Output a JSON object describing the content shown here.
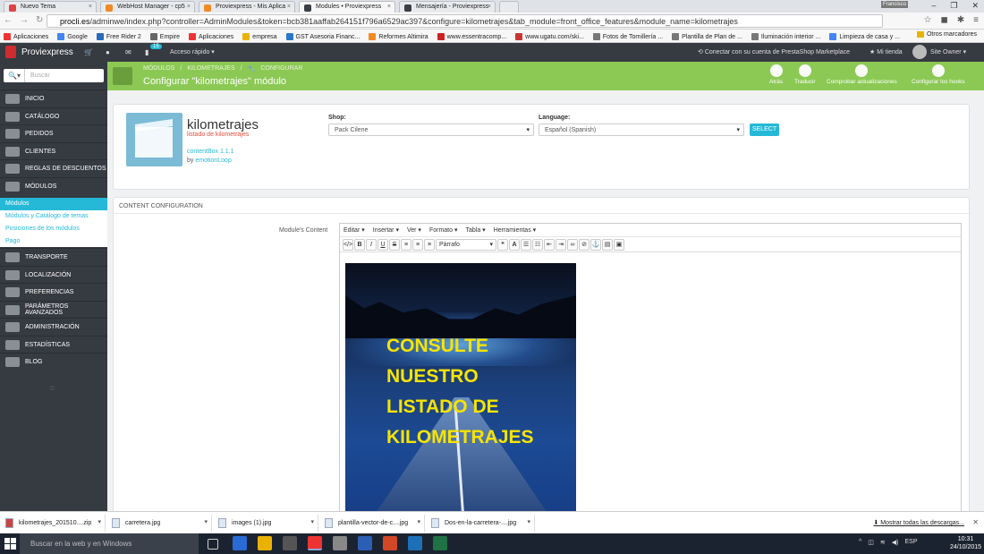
{
  "browser": {
    "tabs": [
      {
        "title": "Nuevo Tema",
        "color": "#d44"
      },
      {
        "title": "WebHost Manager - cp5",
        "color": "#f08a24"
      },
      {
        "title": "Proviexpress - Mis Aplica",
        "color": "#f08a24"
      },
      {
        "title": "Modules • Proviexpress",
        "color": "#3a3f46"
      },
      {
        "title": "Mensajería - Proviexpress",
        "color": "#3a3f46"
      }
    ],
    "user_badge": "Francisco",
    "url_domain": "procli.es",
    "url_path": "/adminwe/index.php?controller=AdminModules&token=bcb381aaffab264151f796a6529ac397&configure=kilometrajes&tab_module=front_office_features&module_name=kilometrajes",
    "bookmarks": [
      {
        "label": "Aplicaciones",
        "color": "#e33"
      },
      {
        "label": "Google",
        "color": "#4285f4"
      },
      {
        "label": "Free Rider 2",
        "color": "#2a6ab8"
      },
      {
        "label": "Empire",
        "color": "#666"
      },
      {
        "label": "Aplicaciones",
        "color": "#e33"
      },
      {
        "label": "empresa",
        "color": "#e9b200"
      },
      {
        "label": "GST Asesoria Financ...",
        "color": "#2a77c9"
      },
      {
        "label": "Reformes Altimira",
        "color": "#f08a24"
      },
      {
        "label": "www.essentracomp...",
        "color": "#c22"
      },
      {
        "label": "www.ugatu.com/ski...",
        "color": "#c33"
      },
      {
        "label": "Fotos de Tornillería ...",
        "color": "#777"
      },
      {
        "label": "Plantilla de Plan de ...",
        "color": "#777"
      },
      {
        "label": "Iluminación interior ...",
        "color": "#777"
      },
      {
        "label": "Limpieza de casa y ...",
        "color": "#4285f4"
      }
    ],
    "other_bookmarks": "Otros marcadores"
  },
  "header": {
    "brand": "Proviexpress",
    "notif_count": "15",
    "quick_access": "Acceso rápido",
    "marketplace": "Conectar con su cuenta de PrestaShop Marketplace",
    "my_shop": "Mi tienda",
    "owner": "Site Owner"
  },
  "sidebar": {
    "search_placeholder": "Buscar",
    "items": [
      {
        "label": "Inicio"
      },
      {
        "label": "Catálogo"
      },
      {
        "label": "Pedidos"
      },
      {
        "label": "Clientes"
      },
      {
        "label": "Reglas de descuentos"
      },
      {
        "label": "Módulos"
      },
      {
        "label": "Transporte"
      },
      {
        "label": "Localización"
      },
      {
        "label": "Preferencias"
      },
      {
        "label": "Parámetros avanzados"
      },
      {
        "label": "Administración"
      },
      {
        "label": "Estadísticas"
      },
      {
        "label": "Blog"
      }
    ],
    "submenu": [
      {
        "label": "Módulos"
      },
      {
        "label": "Módulos y Catálogo de temas"
      },
      {
        "label": "Posiciones de los módulos"
      },
      {
        "label": "Pago"
      }
    ]
  },
  "toolbar": {
    "breadcrumb": [
      "MÓDULOS",
      "KILOMETRAJES",
      "CONFIGURAR"
    ],
    "title": "Configurar \"kilometrajes\" módulo",
    "buttons": [
      "Atrás",
      "Traducir",
      "Comprobar actualizaciones",
      "Configurar los hooks"
    ]
  },
  "module": {
    "name": "kilometrajes",
    "subtitle": "listado de kilometrajes",
    "version": "contentBox 1.1.1",
    "by_prefix": "by",
    "by_author": "emotionLoop"
  },
  "selectors": {
    "shop_label": "Shop:",
    "shop_value": "Pack Cilene",
    "language_label": "Language:",
    "language_value": "Español (Spanish)",
    "select_button": "SELECT"
  },
  "content_config": {
    "heading": "CONTENT CONFIGURATION",
    "field_label": "Module's Content",
    "editor_menu": [
      "Editar",
      "Insertar",
      "Ver",
      "Formato",
      "Tabla",
      "Herramientas"
    ],
    "format_select": "Párrafo",
    "image_text": [
      "CONSULTE",
      "NUESTRO",
      "LISTADO DE",
      "KILOMETRAJES"
    ]
  },
  "downloads": {
    "items": [
      "kilometrajes_201510....zip",
      "carretera.jpg",
      "images (1).jpg",
      "plantilla-vector-de-c....jpg",
      "Dos-en-la-carretera-....jpg"
    ],
    "show_all": "Mostrar todas las descargas..."
  },
  "taskbar": {
    "search": "Buscar en la web y en Windows",
    "lang": "ESP",
    "time": "10:31",
    "date": "24/10/2015"
  }
}
